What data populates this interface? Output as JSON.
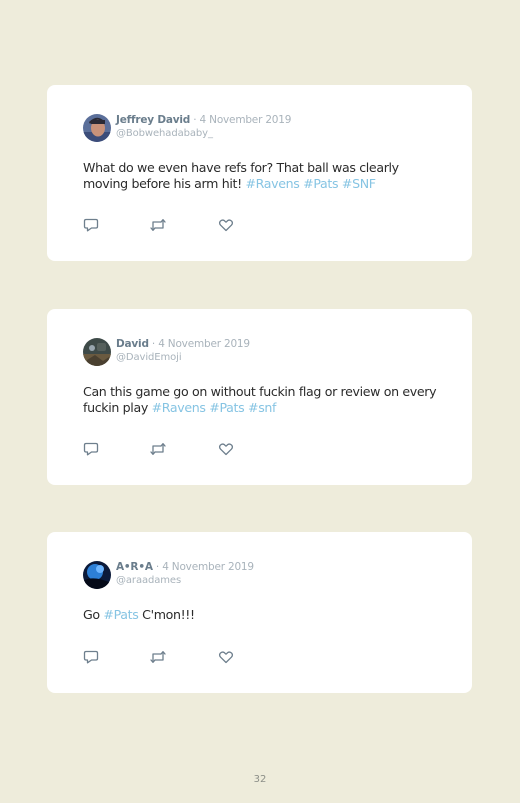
{
  "tweets": [
    {
      "name": "Jeffrey David",
      "separator": " · ",
      "date": "4 November 2019",
      "handle": "@Bobwehadababy_",
      "text": [
        {
          "t": "What do we even have refs for? That ball was clearly moving before his arm hit! ",
          "tag": false
        },
        {
          "t": "#Ravens",
          "tag": true
        },
        {
          "t": " ",
          "tag": false
        },
        {
          "t": "#Pats",
          "tag": true
        },
        {
          "t": " ",
          "tag": false
        },
        {
          "t": "#SNF",
          "tag": true
        }
      ],
      "avatar_colors": [
        "#5b6f9a",
        "#c8927a",
        "#2a2a35"
      ],
      "icons": [
        "reply-icon",
        "retweet-icon",
        "like-icon"
      ]
    },
    {
      "name": "David",
      "separator": " · ",
      "date": "4 November 2019",
      "handle": "@DavidEmoji",
      "text": [
        {
          "t": "Can this game go on without fuckin flag or review on every fuckin play ",
          "tag": false
        },
        {
          "t": "#Ravens",
          "tag": true
        },
        {
          "t": " ",
          "tag": false
        },
        {
          "t": "#Pats",
          "tag": true
        },
        {
          "t": " ",
          "tag": false
        },
        {
          "t": "#snf",
          "tag": true
        }
      ],
      "avatar_colors": [
        "#3e4a48",
        "#6a5a40",
        "#9aa7b0"
      ],
      "icons": [
        "reply-icon",
        "retweet-icon",
        "like-icon"
      ]
    },
    {
      "name": "A•R•A",
      "separator": " · ",
      "date": "4 November 2019",
      "handle": "@araadames",
      "text": [
        {
          "t": "Go ",
          "tag": false
        },
        {
          "t": "#Pats",
          "tag": true
        },
        {
          "t": " C'mon!!!",
          "tag": false
        }
      ],
      "avatar_colors": [
        "#0c1a3a",
        "#2d7fd6",
        "#6fb6ff"
      ],
      "icons": [
        "reply-icon",
        "retweet-icon",
        "like-icon"
      ]
    }
  ],
  "page_number": "32",
  "colors": {
    "background": "#eeecdb",
    "card": "#ffffff",
    "hashtag": "#86c4e3",
    "name": "#6a7d8c",
    "muted": "#a9b3bb",
    "icon": "#6e7f8d"
  }
}
